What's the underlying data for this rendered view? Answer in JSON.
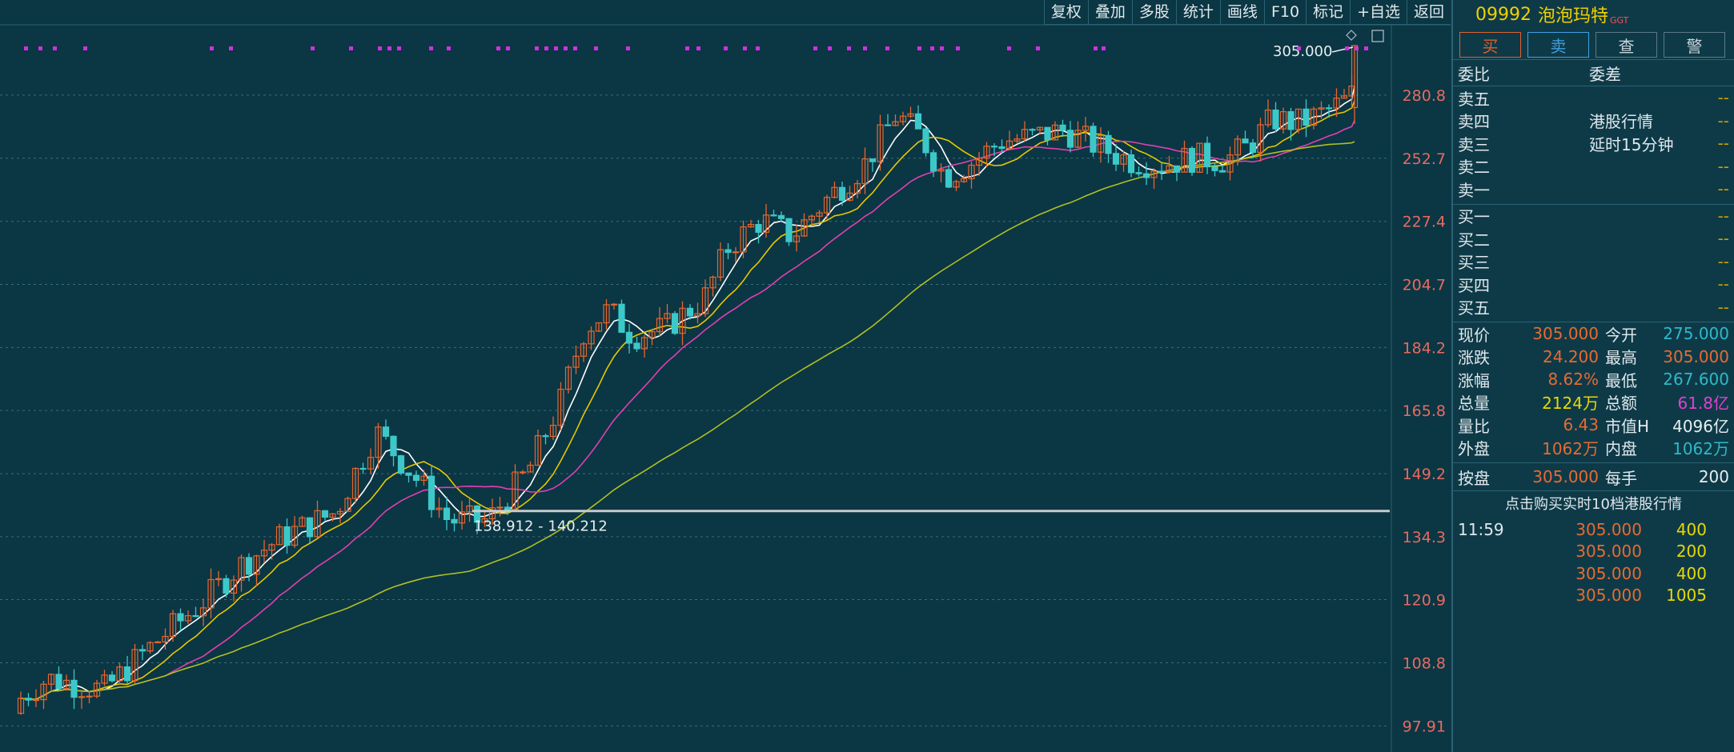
{
  "toolbar": {
    "items": [
      "复权",
      "叠加",
      "多股",
      "统计",
      "画线",
      "F10",
      "标记",
      "+自选",
      "返回"
    ]
  },
  "stock": {
    "code": "09992",
    "name": "泡泡玛特",
    "tag": "GGT"
  },
  "trade_buttons": [
    "买",
    "卖",
    "查",
    "警"
  ],
  "order_book": {
    "header": {
      "left": "委比",
      "right": "委差"
    },
    "sells": [
      {
        "label": "卖五",
        "note": "",
        "value": "--"
      },
      {
        "label": "卖四",
        "note": "港股行情",
        "value": "--"
      },
      {
        "label": "卖三",
        "note": "延时15分钟",
        "value": "--"
      },
      {
        "label": "卖二",
        "note": "",
        "value": "--"
      },
      {
        "label": "卖一",
        "note": "",
        "value": "--"
      }
    ],
    "buys": [
      {
        "label": "买一",
        "value": "--"
      },
      {
        "label": "买二",
        "value": "--"
      },
      {
        "label": "买三",
        "value": "--"
      },
      {
        "label": "买四",
        "value": "--"
      },
      {
        "label": "买五",
        "value": "--"
      }
    ]
  },
  "quote": [
    {
      "k1": "现价",
      "v1": "305.000",
      "c1": "red",
      "k2": "今开",
      "v2": "275.000",
      "c2": "cyan"
    },
    {
      "k1": "涨跌",
      "v1": "24.200",
      "c1": "red",
      "k2": "最高",
      "v2": "305.000",
      "c2": "red"
    },
    {
      "k1": "涨幅",
      "v1": "8.62%",
      "c1": "red",
      "k2": "最低",
      "v2": "267.600",
      "c2": "cyan"
    },
    {
      "k1": "总量",
      "v1": "2124万",
      "c1": "yellow",
      "k2": "总额",
      "v2": "61.8亿",
      "c2": "magenta"
    },
    {
      "k1": "量比",
      "v1": "6.43",
      "c1": "red",
      "k2": "市值H",
      "v2": "4096亿",
      "c2": "white"
    },
    {
      "k1": "外盘",
      "v1": "1062万",
      "c1": "red",
      "k2": "内盘",
      "v2": "1062万",
      "c2": "cyan"
    }
  ],
  "close_row": {
    "k1": "按盘",
    "v1": "305.000",
    "k2": "每手",
    "v2": "200"
  },
  "ticks_note": "点击购买实时10档港股行情",
  "ticks": [
    {
      "time": "11:59",
      "price": "305.000",
      "vol": "400"
    },
    {
      "time": "",
      "price": "305.000",
      "vol": "200"
    },
    {
      "time": "",
      "price": "305.000",
      "vol": "400"
    },
    {
      "time": "",
      "price": "305.000",
      "vol": "1005"
    }
  ],
  "chart_data": {
    "type": "candlestick",
    "y_ticks": [
      "280.8",
      "252.7",
      "227.4",
      "204.7",
      "184.2",
      "165.8",
      "149.2",
      "134.3",
      "120.9",
      "108.8",
      "97.91"
    ],
    "y_scale": "log",
    "ylim": [
      95,
      312
    ],
    "high_label": "305.000",
    "range_label": "138.912 - 140.212",
    "range_level": 140.2
  },
  "colors": {
    "up": "#e8662c",
    "down": "#3cc8c8",
    "ma5": "#ffffff",
    "ma10": "#e8c800",
    "ma20": "#e040b0",
    "ma60": "#b0c020"
  }
}
